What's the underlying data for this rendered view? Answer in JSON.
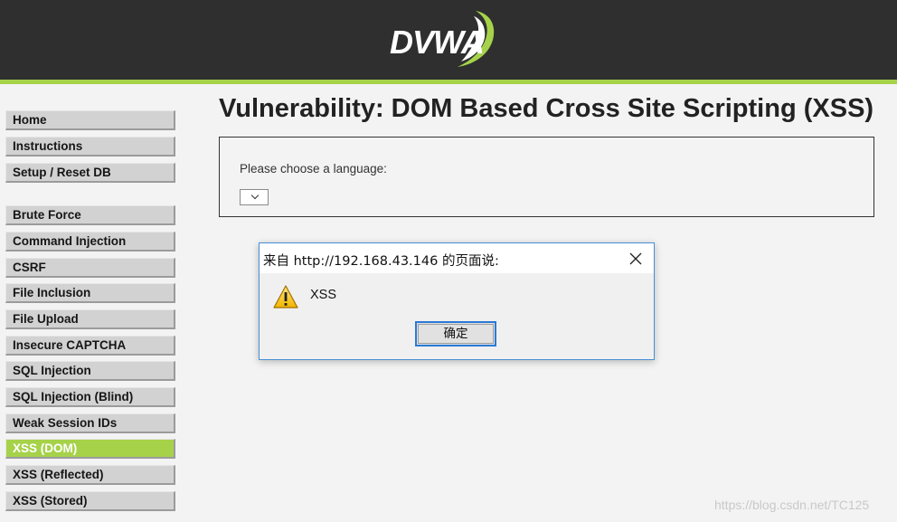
{
  "header": {
    "logo_text": "DVWA"
  },
  "sidebar": {
    "group1": [
      "Home",
      "Instructions",
      "Setup / Reset DB"
    ],
    "group2": [
      "Brute Force",
      "Command Injection",
      "CSRF",
      "File Inclusion",
      "File Upload",
      "Insecure CAPTCHA",
      "SQL Injection",
      "SQL Injection (Blind)",
      "Weak Session IDs",
      "XSS (DOM)",
      "XSS (Reflected)",
      "XSS (Stored)"
    ],
    "active": "XSS (DOM)"
  },
  "main": {
    "title": "Vulnerability: DOM Based Cross Site Scripting (XSS)",
    "language_label": "Please choose a language:",
    "language_selected": ""
  },
  "dialog": {
    "title": "来自 http://192.168.43.146 的页面说:",
    "message": "XSS",
    "ok_label": "确定"
  },
  "watermark": "https://blog.csdn.net/TC125",
  "colors": {
    "header_bg": "#2f2f2f",
    "accent": "#a6d24a",
    "nav_bg": "#d2d2d2",
    "dialog_border": "#4a8fd6"
  }
}
